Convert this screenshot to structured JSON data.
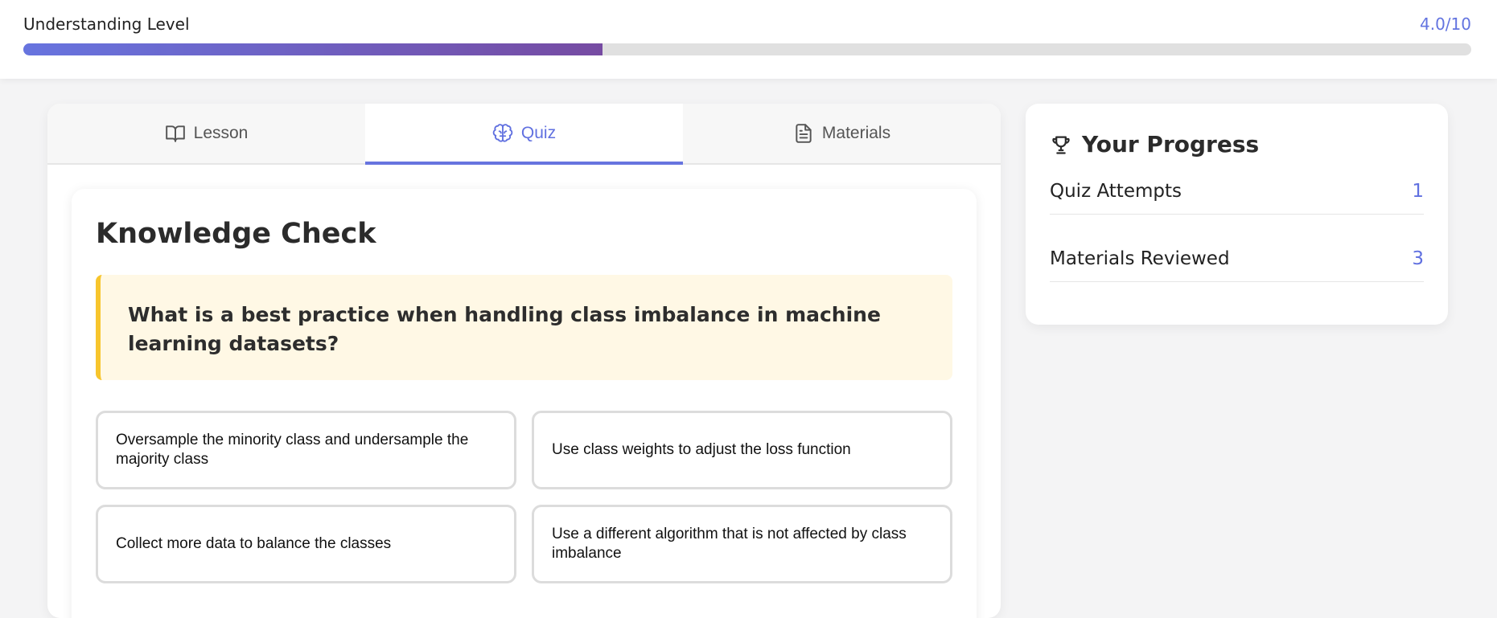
{
  "understanding": {
    "label": "Understanding Level",
    "score_text": "4.0/10",
    "level": 0.4
  },
  "tabs": [
    {
      "label": "Lesson",
      "icon": "book-icon",
      "active": false
    },
    {
      "label": "Quiz",
      "icon": "brain-icon",
      "active": true
    },
    {
      "label": "Materials",
      "icon": "document-icon",
      "active": false
    }
  ],
  "quiz": {
    "title": "Knowledge Check",
    "question": "What is a best practice when handling class imbalance in machine learning datasets?",
    "options": [
      "Oversample the minority class and undersample the majority class",
      "Use class weights to adjust the loss function",
      "Collect more data to balance the classes",
      "Use a different algorithm that is not affected by class imbalance"
    ]
  },
  "progress": {
    "title": "Your Progress",
    "icon": "trophy-icon",
    "stats": [
      {
        "label": "Quiz Attempts",
        "value": "1"
      },
      {
        "label": "Materials Reviewed",
        "value": "3"
      }
    ]
  },
  "colors": {
    "accent": "#6774df",
    "gradient_end": "#764ba2",
    "question_bg": "#fff8e5",
    "question_border": "#f7c52c"
  }
}
